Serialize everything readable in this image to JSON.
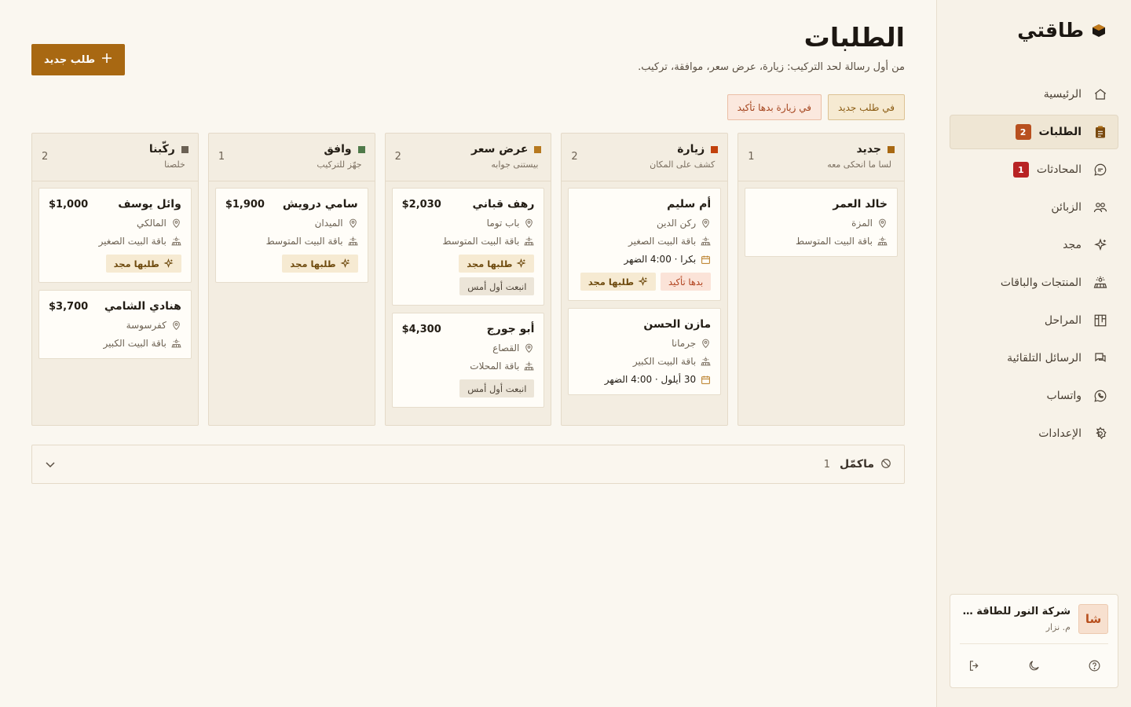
{
  "app": {
    "name": "طاقتي"
  },
  "sidebar": {
    "items": [
      {
        "label": "الرئيسية",
        "icon": "home-icon"
      },
      {
        "label": "الطلبات",
        "icon": "clipboard-icon",
        "badge": "2",
        "active": true
      },
      {
        "label": "المحادثات",
        "icon": "chat-icon",
        "badge": "1"
      },
      {
        "label": "الزبائن",
        "icon": "users-icon"
      },
      {
        "label": "مجد",
        "icon": "sparkle-icon"
      },
      {
        "label": "المنتجات والباقات",
        "icon": "solar-panel-icon"
      },
      {
        "label": "المراحل",
        "icon": "kanban-icon"
      },
      {
        "label": "الرسائل التلقائية",
        "icon": "messages-icon"
      },
      {
        "label": "واتساب",
        "icon": "whatsapp-icon"
      },
      {
        "label": "الإعدادات",
        "icon": "gear-icon"
      }
    ],
    "account": {
      "avatar": "شا",
      "company": "شركة النور للطاقة الشمسية",
      "user": "م. نزار"
    }
  },
  "header": {
    "title": "الطلبات",
    "subtitle": "من أول رسالة لحد التركيب: زيارة، عرض سعر، موافقة، تركيب.",
    "new_button": "طلب جديد"
  },
  "filters": [
    "في طلب جديد",
    "في زيارة بدها تأكيد"
  ],
  "columns": [
    {
      "title": "جديد",
      "subtitle": "لسا ما انحكى معه",
      "count": "1",
      "color": "#a86812",
      "cards": [
        {
          "name": "خالد العمر",
          "price": "",
          "location": "المزة",
          "package": "باقة البيت المتوسط",
          "date": "",
          "tags": []
        }
      ]
    },
    {
      "title": "زيارة",
      "subtitle": "كشف على المكان",
      "count": "2",
      "color": "#c2410c",
      "cards": [
        {
          "name": "أم سليم",
          "price": "",
          "location": "ركن الدين",
          "package": "باقة البيت الصغير",
          "date": "بكرا · 4:00 الضهر",
          "tags": [
            {
              "type": "confirm",
              "label": "بدها تأكيد"
            },
            {
              "type": "majd",
              "label": "طلبها مجد"
            }
          ]
        },
        {
          "name": "مازن الحسن",
          "price": "",
          "location": "جرمانا",
          "package": "باقة البيت الكبير",
          "date": "30 أيلول · 4:00 الضهر",
          "tags": []
        }
      ]
    },
    {
      "title": "عرض سعر",
      "subtitle": "بيستنى جوابه",
      "count": "2",
      "color": "#b7791f",
      "cards": [
        {
          "name": "رهف قباني",
          "price": "$2,030",
          "location": "باب توما",
          "package": "باقة البيت المتوسط",
          "date": "",
          "tags": [
            {
              "type": "majd",
              "label": "طلبها مجد"
            },
            {
              "type": "stale",
              "label": "انبعت أول أمس"
            }
          ]
        },
        {
          "name": "أبو جورج",
          "price": "$4,300",
          "location": "القصاع",
          "package": "باقة المحلات",
          "date": "",
          "tags": [
            {
              "type": "stale",
              "label": "انبعت أول أمس"
            }
          ]
        }
      ]
    },
    {
      "title": "وافق",
      "subtitle": "جهّز للتركيب",
      "count": "1",
      "color": "#4f7a4a",
      "cards": [
        {
          "name": "سامي درويش",
          "price": "$1,900",
          "location": "الميدان",
          "package": "باقة البيت المتوسط",
          "date": "",
          "tags": [
            {
              "type": "majd",
              "label": "طلبها مجد"
            }
          ]
        }
      ]
    },
    {
      "title": "ركّبنا",
      "subtitle": "خلصنا",
      "count": "2",
      "color": "#6b6154",
      "cards": [
        {
          "name": "وائل يوسف",
          "price": "$1,000",
          "location": "المالكي",
          "package": "باقة البيت الصغير",
          "date": "",
          "tags": [
            {
              "type": "majd",
              "label": "طلبها مجد"
            }
          ]
        },
        {
          "name": "هنادي الشامي",
          "price": "$3,700",
          "location": "كفرسوسة",
          "package": "باقة البيت الكبير",
          "date": "",
          "tags": []
        }
      ]
    }
  ],
  "closed": {
    "label": "ماكمّل",
    "count": "1"
  }
}
